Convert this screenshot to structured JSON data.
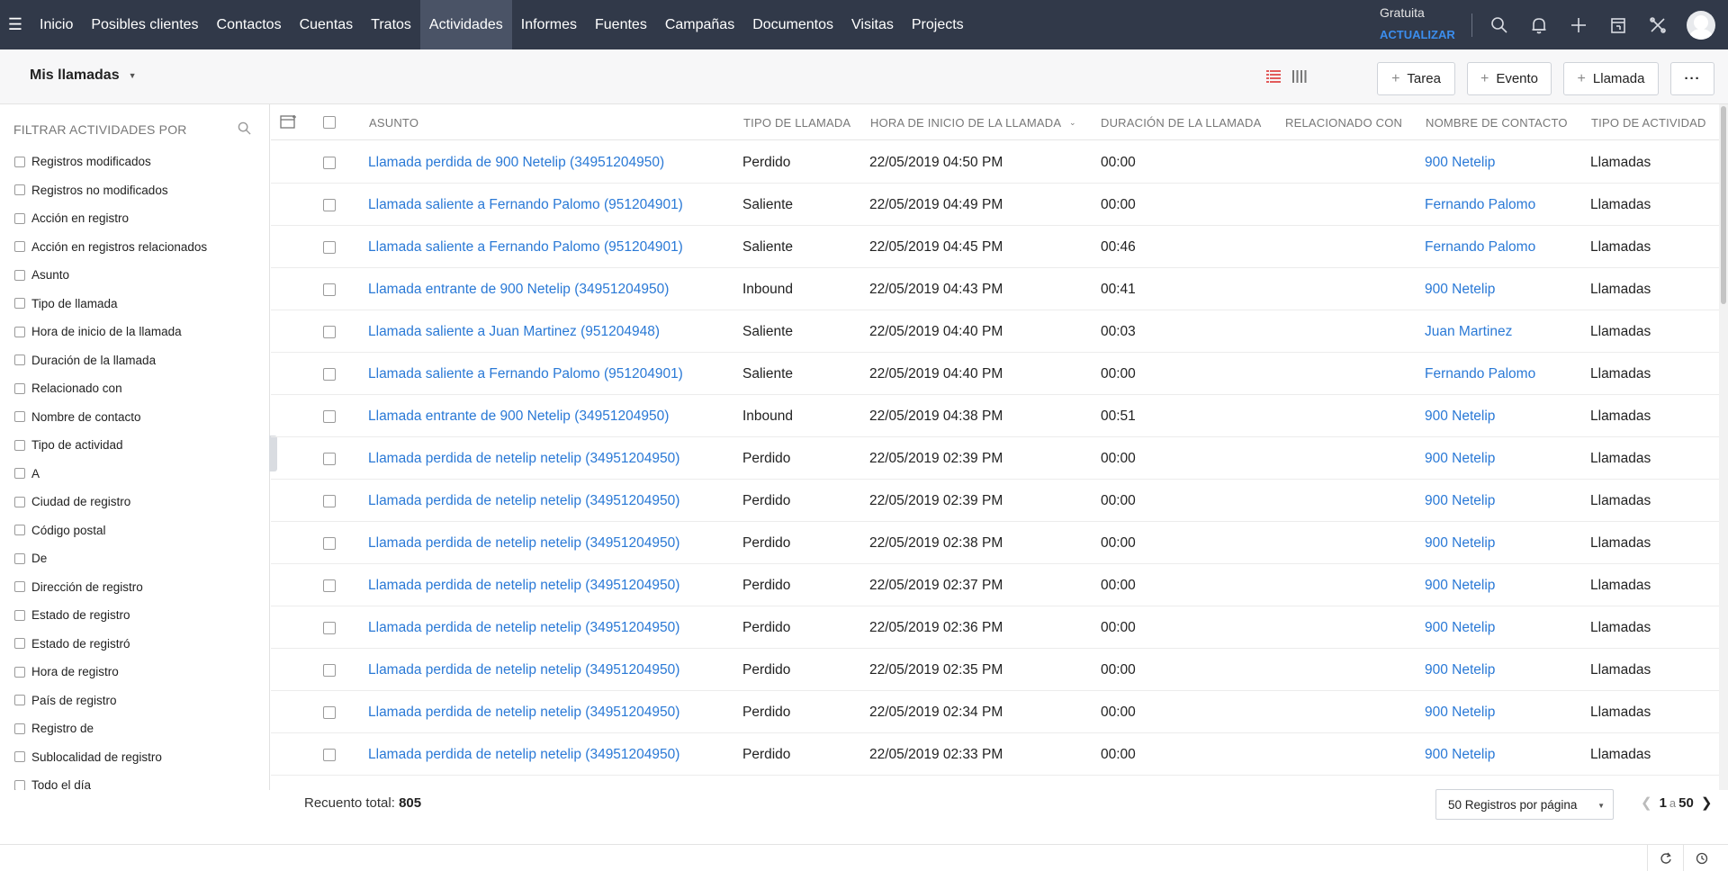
{
  "nav": {
    "tabs": [
      {
        "label": "Inicio"
      },
      {
        "label": "Posibles clientes"
      },
      {
        "label": "Contactos"
      },
      {
        "label": "Cuentas"
      },
      {
        "label": "Tratos"
      },
      {
        "label": "Actividades"
      },
      {
        "label": "Informes"
      },
      {
        "label": "Fuentes"
      },
      {
        "label": "Campañas"
      },
      {
        "label": "Documentos"
      },
      {
        "label": "Visitas"
      },
      {
        "label": "Projects"
      }
    ],
    "active_tab": "Actividades",
    "plan_label": "Gratuita",
    "upgrade_label": "ACTUALIZAR",
    "icons": [
      "search-icon",
      "bell-icon",
      "plus-icon",
      "calendar-icon",
      "tools-icon",
      "avatar"
    ]
  },
  "toolbar": {
    "view_name": "Mis llamadas",
    "task_label": "Tarea",
    "event_label": "Evento",
    "call_label": "Llamada",
    "more_label": "···"
  },
  "sidebar": {
    "heading": "FILTRAR ACTIVIDADES POR",
    "filters": [
      "Registros modificados",
      "Registros no modificados",
      "Acción en registro",
      "Acción en registros relacionados",
      "Asunto",
      "Tipo de llamada",
      "Hora de inicio de la llamada",
      "Duración de la llamada",
      "Relacionado con",
      "Nombre de contacto",
      "Tipo de actividad",
      "A",
      "Ciudad de registro",
      "Código postal",
      "De",
      "Dirección de registro",
      "Estado de registro",
      "Estado de registró",
      "Hora de registro",
      "País de registro",
      "Registro de",
      "Sublocalidad de registro",
      "Todo el día"
    ]
  },
  "table": {
    "columns": [
      "ASUNTO",
      "TIPO DE LLAMADA",
      "HORA DE INICIO DE LA LLAMADA",
      "DURACIÓN DE LA LLAMADA",
      "RELACIONADO CON",
      "NOMBRE DE CONTACTO",
      "TIPO DE ACTIVIDAD"
    ],
    "rows": [
      {
        "subject": "Llamada perdida de 900 Netelip (34951204950)",
        "type": "Perdido",
        "start": "22/05/2019 04:50 PM",
        "duration": "00:00",
        "related": "",
        "contact": "900 Netelip",
        "activity": "Llamadas"
      },
      {
        "subject": "Llamada saliente a Fernando Palomo (951204901)",
        "type": "Saliente",
        "start": "22/05/2019 04:49 PM",
        "duration": "00:00",
        "related": "",
        "contact": "Fernando Palomo",
        "activity": "Llamadas"
      },
      {
        "subject": "Llamada saliente a Fernando Palomo (951204901)",
        "type": "Saliente",
        "start": "22/05/2019 04:45 PM",
        "duration": "00:46",
        "related": "",
        "contact": "Fernando Palomo",
        "activity": "Llamadas"
      },
      {
        "subject": "Llamada entrante de 900 Netelip (34951204950)",
        "type": "Inbound",
        "start": "22/05/2019 04:43 PM",
        "duration": "00:41",
        "related": "",
        "contact": "900 Netelip",
        "activity": "Llamadas"
      },
      {
        "subject": "Llamada saliente a Juan Martinez (951204948)",
        "type": "Saliente",
        "start": "22/05/2019 04:40 PM",
        "duration": "00:03",
        "related": "",
        "contact": "Juan Martinez",
        "activity": "Llamadas"
      },
      {
        "subject": "Llamada saliente a Fernando Palomo (951204901)",
        "type": "Saliente",
        "start": "22/05/2019 04:40 PM",
        "duration": "00:00",
        "related": "",
        "contact": "Fernando Palomo",
        "activity": "Llamadas"
      },
      {
        "subject": "Llamada entrante de 900 Netelip (34951204950)",
        "type": "Inbound",
        "start": "22/05/2019 04:38 PM",
        "duration": "00:51",
        "related": "",
        "contact": "900 Netelip",
        "activity": "Llamadas"
      },
      {
        "subject": "Llamada perdida de netelip netelip (34951204950)",
        "type": "Perdido",
        "start": "22/05/2019 02:39 PM",
        "duration": "00:00",
        "related": "",
        "contact": "900 Netelip",
        "activity": "Llamadas"
      },
      {
        "subject": "Llamada perdida de netelip netelip (34951204950)",
        "type": "Perdido",
        "start": "22/05/2019 02:39 PM",
        "duration": "00:00",
        "related": "",
        "contact": "900 Netelip",
        "activity": "Llamadas"
      },
      {
        "subject": "Llamada perdida de netelip netelip (34951204950)",
        "type": "Perdido",
        "start": "22/05/2019 02:38 PM",
        "duration": "00:00",
        "related": "",
        "contact": "900 Netelip",
        "activity": "Llamadas"
      },
      {
        "subject": "Llamada perdida de netelip netelip (34951204950)",
        "type": "Perdido",
        "start": "22/05/2019 02:37 PM",
        "duration": "00:00",
        "related": "",
        "contact": "900 Netelip",
        "activity": "Llamadas"
      },
      {
        "subject": "Llamada perdida de netelip netelip (34951204950)",
        "type": "Perdido",
        "start": "22/05/2019 02:36 PM",
        "duration": "00:00",
        "related": "",
        "contact": "900 Netelip",
        "activity": "Llamadas"
      },
      {
        "subject": "Llamada perdida de netelip netelip (34951204950)",
        "type": "Perdido",
        "start": "22/05/2019 02:35 PM",
        "duration": "00:00",
        "related": "",
        "contact": "900 Netelip",
        "activity": "Llamadas"
      },
      {
        "subject": "Llamada perdida de netelip netelip (34951204950)",
        "type": "Perdido",
        "start": "22/05/2019 02:34 PM",
        "duration": "00:00",
        "related": "",
        "contact": "900 Netelip",
        "activity": "Llamadas"
      },
      {
        "subject": "Llamada perdida de netelip netelip (34951204950)",
        "type": "Perdido",
        "start": "22/05/2019 02:33 PM",
        "duration": "00:00",
        "related": "",
        "contact": "900 Netelip",
        "activity": "Llamadas"
      }
    ]
  },
  "footer": {
    "total_label": "Recuento total:",
    "total_count": "805",
    "per_page": "50 Registros por página",
    "page_from": "1",
    "page_sep": "a",
    "page_to": "50"
  },
  "colors": {
    "nav_bg": "#313949",
    "nav_active": "#4a5366",
    "link": "#2a79d6",
    "upgrade": "#3b8ded"
  }
}
